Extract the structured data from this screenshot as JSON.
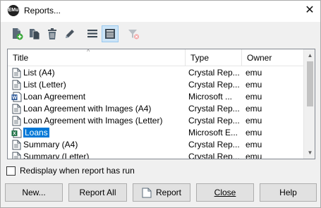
{
  "window": {
    "title": "Reports..."
  },
  "toolbar": {
    "items": [
      {
        "name": "new-report-icon"
      },
      {
        "name": "copy-report-icon"
      },
      {
        "name": "delete-icon"
      },
      {
        "name": "edit-icon"
      },
      {
        "name": "list-view-icon"
      },
      {
        "name": "detail-view-icon"
      },
      {
        "name": "clear-filter-icon"
      }
    ]
  },
  "list": {
    "columns": [
      "Title",
      "Type",
      "Owner"
    ],
    "rows": [
      {
        "title": "List (A4)",
        "type": "Crystal Rep...",
        "owner": "emu",
        "icon": "document-icon"
      },
      {
        "title": "List (Letter)",
        "type": "Crystal Rep...",
        "owner": "emu",
        "icon": "document-icon"
      },
      {
        "title": "Loan Agreement",
        "type": "Microsoft ...",
        "owner": "emu",
        "icon": "word-icon"
      },
      {
        "title": "Loan Agreement with Images (A4)",
        "type": "Crystal Rep...",
        "owner": "emu",
        "icon": "document-icon"
      },
      {
        "title": "Loan Agreement with Images (Letter)",
        "type": "Crystal Rep...",
        "owner": "emu",
        "icon": "document-icon"
      },
      {
        "title": "Loans",
        "type": "Microsoft E...",
        "owner": "emu",
        "icon": "excel-icon",
        "selected": true
      },
      {
        "title": "Summary (A4)",
        "type": "Crystal Rep...",
        "owner": "emu",
        "icon": "document-icon"
      },
      {
        "title": "Summary (Letter)",
        "type": "Crystal Rep...",
        "owner": "emu",
        "icon": "document-icon"
      }
    ]
  },
  "options": {
    "redisplay_label": "Redisplay when report has run"
  },
  "buttons": {
    "new": "New...",
    "report_all": "Report All",
    "report": "Report",
    "close": "Close",
    "help": "Help"
  },
  "colors": {
    "selection": "#0078d7",
    "toolbar_active": "#cce4f7"
  }
}
